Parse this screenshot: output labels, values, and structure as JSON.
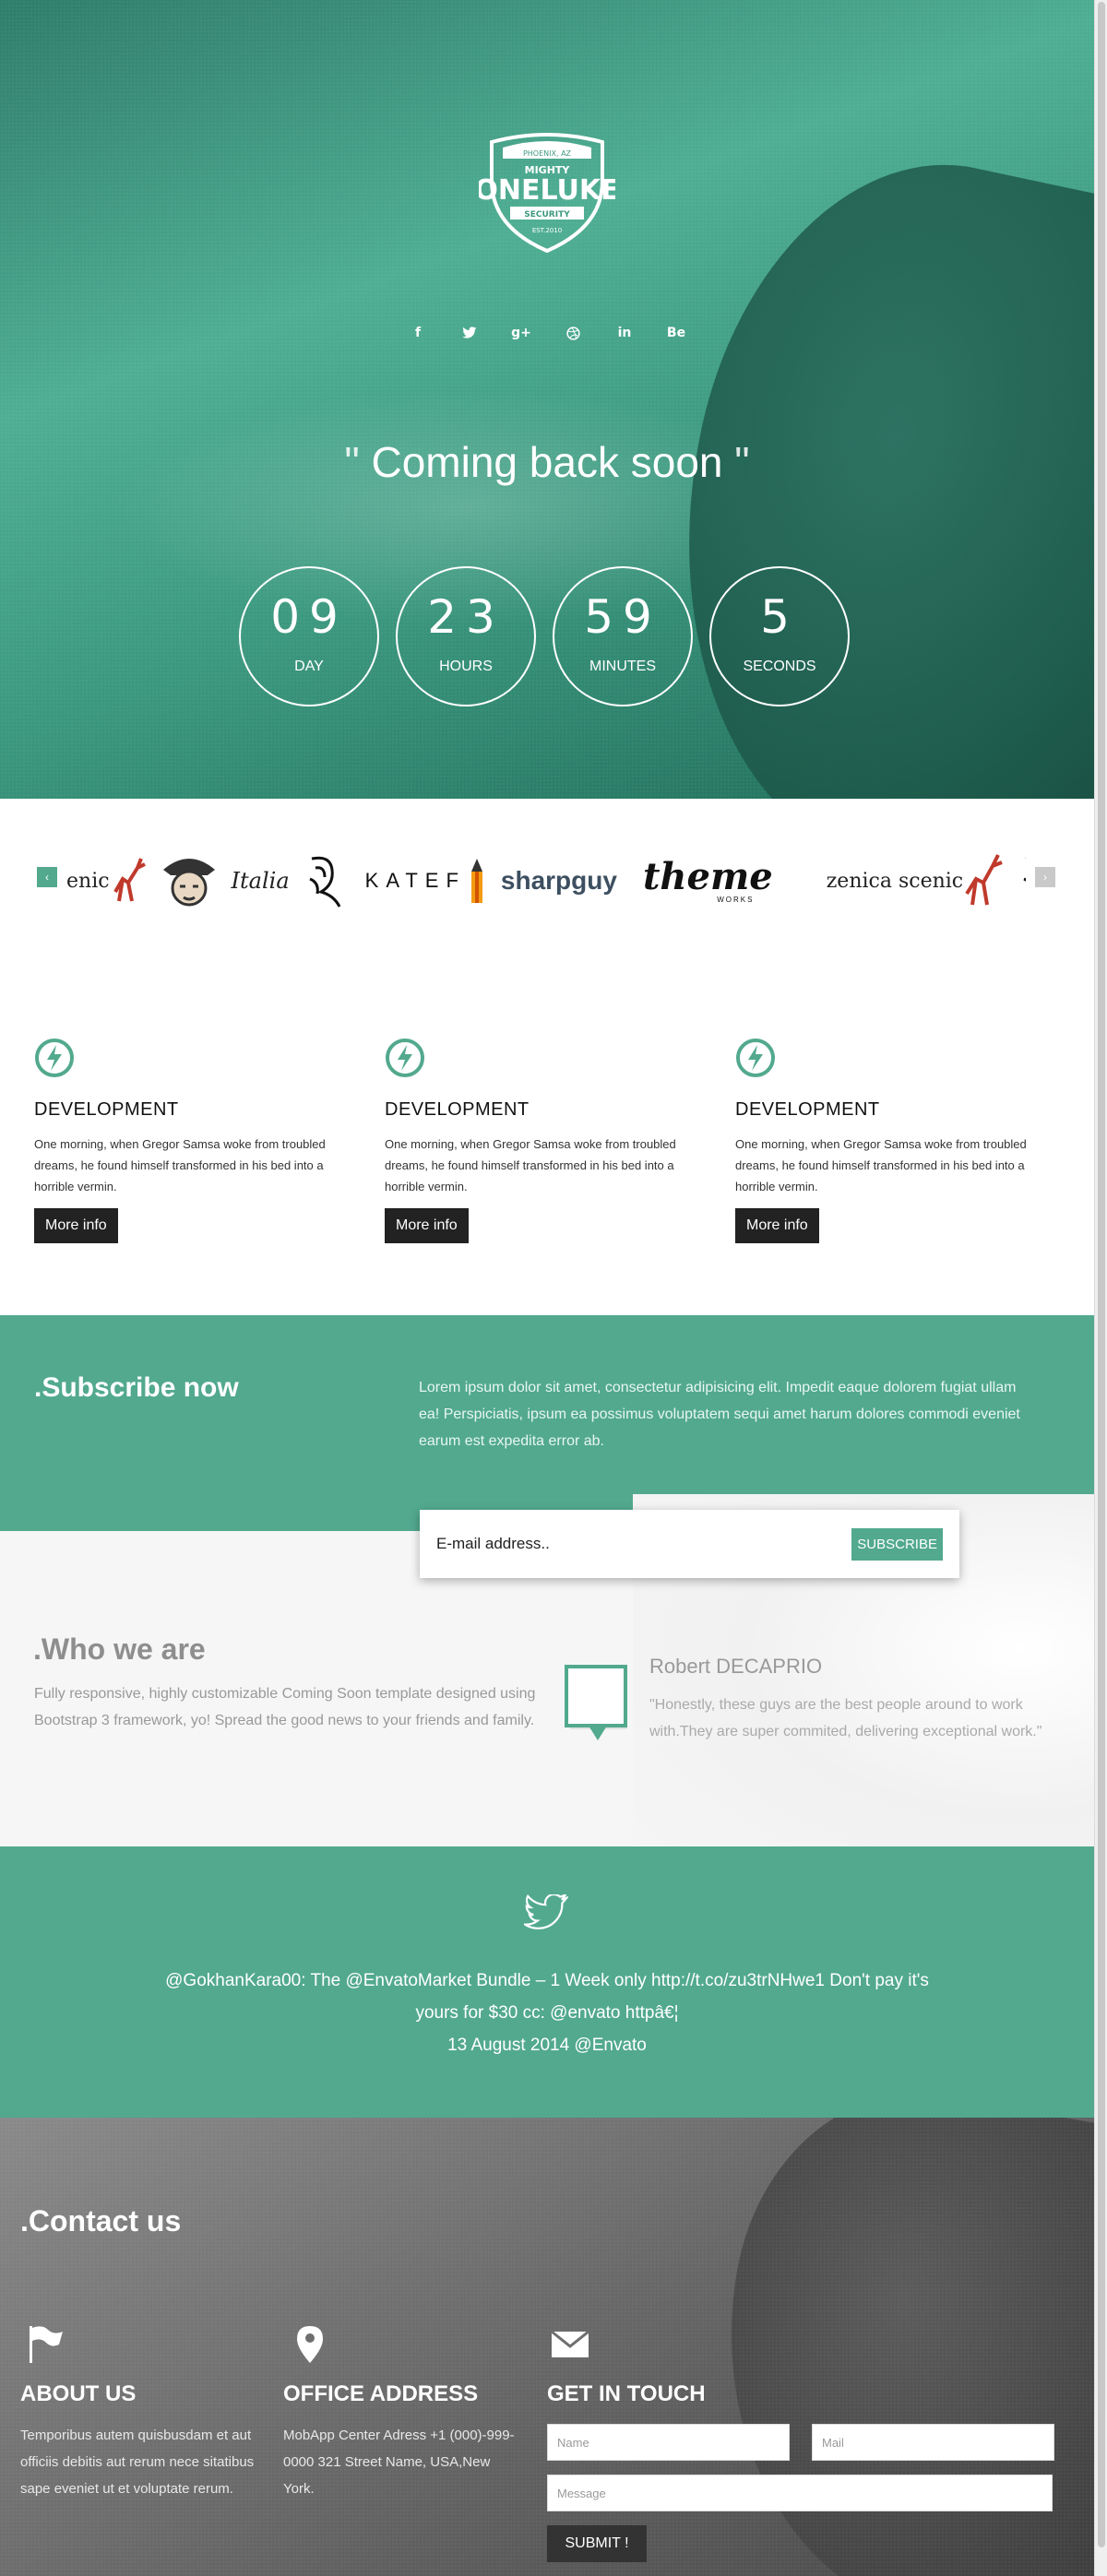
{
  "hero": {
    "logo": {
      "top_text": "PHOENIX, AZ",
      "brand_top": "MIGHTY",
      "brand": "ONELUKE",
      "ribbon": "SECURITY",
      "est": "EST.2010"
    },
    "social": [
      "f",
      "t",
      "g+",
      "dribbble",
      "in",
      "Be"
    ],
    "tagline": {
      "open": "\"",
      "pre": "Coming",
      "bold": "back",
      "post": "soon",
      "close": "\""
    },
    "countdown": [
      {
        "num": "09",
        "label": "DAY"
      },
      {
        "num": "23",
        "label": "HOURS"
      },
      {
        "num": "59",
        "label": "MINUTES"
      },
      {
        "num": "5",
        "label": "SECONDS"
      }
    ]
  },
  "clients": {
    "prev_label": "‹",
    "next_label": "›",
    "logos": [
      "enic",
      "Italia",
      "KATEF",
      "sharpguy",
      "theme",
      "WORKS",
      "zenica scenic"
    ]
  },
  "features": [
    {
      "title": "DEVELOPMENT",
      "text": "One morning, when Gregor Samsa woke from troubled dreams, he found himself transformed in his bed into a horrible vermin.",
      "button": "More info"
    },
    {
      "title": "DEVELOPMENT",
      "text": "One morning, when Gregor Samsa woke from troubled dreams, he found himself transformed in his bed into a horrible vermin.",
      "button": "More info"
    },
    {
      "title": "DEVELOPMENT",
      "text": "One morning, when Gregor Samsa woke from troubled dreams, he found himself transformed in his bed into a horrible vermin.",
      "button": "More info"
    }
  ],
  "subscribe": {
    "title": ".Subscribe now",
    "text": "Lorem ipsum dolor sit amet, consectetur adipisicing elit. Impedit eaque dolorem fugiat ullam ea! Perspiciatis, ipsum ea possimus voluptatem sequi amet harum dolores commodi eveniet earum est expedita error ab.",
    "placeholder": "E-mail address..",
    "button": "SUBSCRIBE"
  },
  "who": {
    "title": ".Who we are",
    "text": "Fully responsive, highly customizable Coming Soon template designed using Bootstrap 3 framework, yo! Spread the good news to your friends and family.",
    "quote_name": "Robert DECAPRIO",
    "quote_text": "\"Honestly, these guys are the best people around to work with.They are super commited, delivering exceptional work.\""
  },
  "twitter": {
    "line1": "@GokhanKara00: The @EnvatoMarket Bundle – 1 Week only http://t.co/zu3trNHwe1 Don't pay it's yours for $30 cc: @envato httpâ€¦",
    "line2": "13 August 2014 @Envato"
  },
  "contact": {
    "title": ".Contact us",
    "about": {
      "title": "ABOUT US",
      "text": "Temporibus autem quisbusdam et aut officiis debitis aut rerum nece sitatibus sape eveniet ut et voluptate rerum."
    },
    "office": {
      "title": "OFFICE ADDRESS",
      "text": "MobApp Center Adress +1 (000)-999-0000 321 Street Name, USA,New York."
    },
    "touch": {
      "title": "GET IN TOUCH",
      "name_ph": "Name",
      "mail_ph": "Mail",
      "message_ph": "Message",
      "submit": "SUBMIT !"
    }
  },
  "colors": {
    "accent": "#52a98e",
    "dark": "#222222"
  }
}
